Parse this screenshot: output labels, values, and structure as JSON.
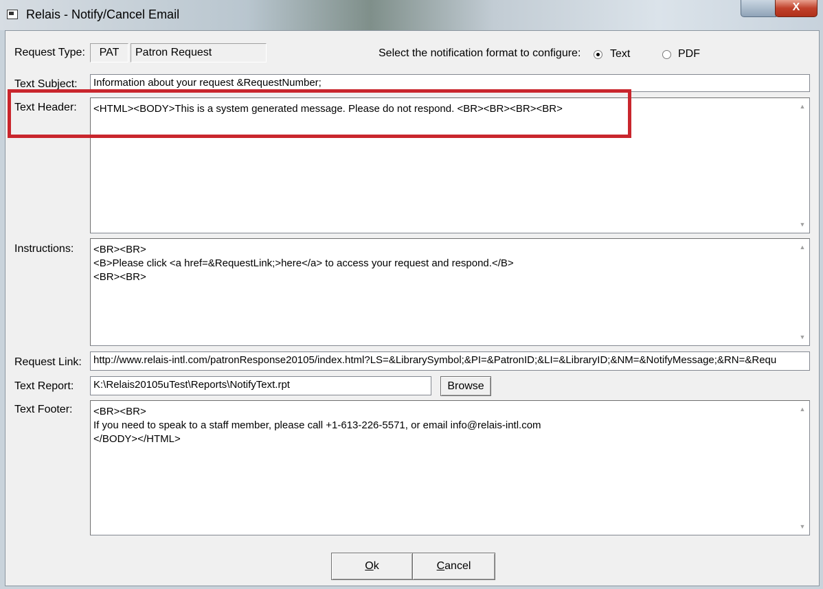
{
  "window": {
    "title": "Relais - Notify/Cancel Email",
    "close_glyph": "X"
  },
  "request_type": {
    "label": "Request Type:",
    "code": "PAT",
    "description": "Patron Request"
  },
  "format": {
    "prompt": "Select the notification format to configure:",
    "options": [
      {
        "label": "Text",
        "selected": true
      },
      {
        "label": "PDF",
        "selected": false
      }
    ]
  },
  "text_subject": {
    "label": "Text Subject:",
    "value": "Information about your request &RequestNumber;"
  },
  "text_header": {
    "label": "Text Header:",
    "value": "<HTML><BODY>This is a system generated message. Please do not respond. <BR><BR><BR><BR>"
  },
  "instructions": {
    "label": "Instructions:",
    "value": "<BR><BR>\n<B>Please click <a href=&RequestLink;>here</a> to access your request and respond.</B>\n<BR><BR>"
  },
  "request_link": {
    "label": "Request Link:",
    "value": "http://www.relais-intl.com/patronResponse20105/index.html?LS=&LibrarySymbol;&PI=&PatronID;&LI=&LibraryID;&NM=&NotifyMessage;&RN=&Requ"
  },
  "text_report": {
    "label": "Text Report:",
    "value": "K:\\Relais20105uTest\\Reports\\NotifyText.rpt",
    "browse_label": "Browse"
  },
  "text_footer": {
    "label": "Text Footer:",
    "value": "<BR><BR>\nIf you need to speak to a staff member, please call +1-613-226-5571, or email info@relais-intl.com\n</BODY></HTML>"
  },
  "buttons": {
    "ok_access": "O",
    "ok_rest": "k",
    "cancel_access": "C",
    "cancel_rest": "ancel"
  },
  "annotation": {
    "highlight_color": "#c9262d"
  }
}
